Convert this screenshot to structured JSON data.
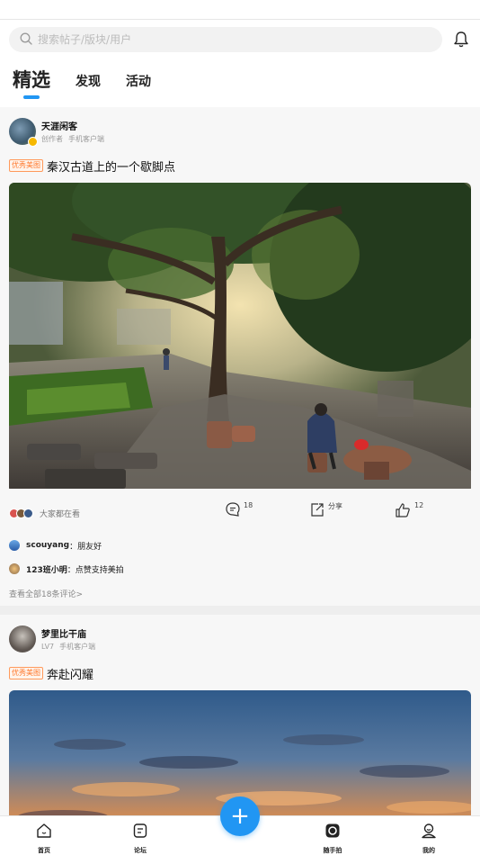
{
  "search": {
    "placeholder": "搜索帖子/版块/用户"
  },
  "tabs": [
    {
      "label": "精选",
      "active": true
    },
    {
      "label": "发现",
      "active": false
    },
    {
      "label": "活动",
      "active": false
    }
  ],
  "posts": [
    {
      "author": "天涯闲客",
      "level": "创作者",
      "client": "手机客户端",
      "tag": "优秀美图",
      "title": "秦汉古道上的一个歇脚点",
      "watchers_text": "大家都在看",
      "comments_count": "18",
      "share_label": "分享",
      "likes_count": "12",
      "comments": [
        {
          "user": "scouyang",
          "text": "：朋友好"
        },
        {
          "user": "123班小明",
          "text": "：点赞支持美拍"
        }
      ],
      "view_all": "查看全部18条评论>"
    },
    {
      "author": "梦里比干庙",
      "level": "LV7",
      "client": "手机客户端",
      "tag": "优秀美图",
      "title": "奔赴闪耀"
    }
  ],
  "bottom_nav": [
    {
      "label": "首页",
      "icon": "home-icon"
    },
    {
      "label": "论坛",
      "icon": "forum-icon"
    },
    {
      "label": "+",
      "icon": "plus-icon"
    },
    {
      "label": "随手拍",
      "icon": "camera-icon"
    },
    {
      "label": "我的",
      "icon": "profile-icon"
    }
  ],
  "colors": {
    "accent": "#2196f3",
    "tag_orange": "#ff7a2f"
  }
}
